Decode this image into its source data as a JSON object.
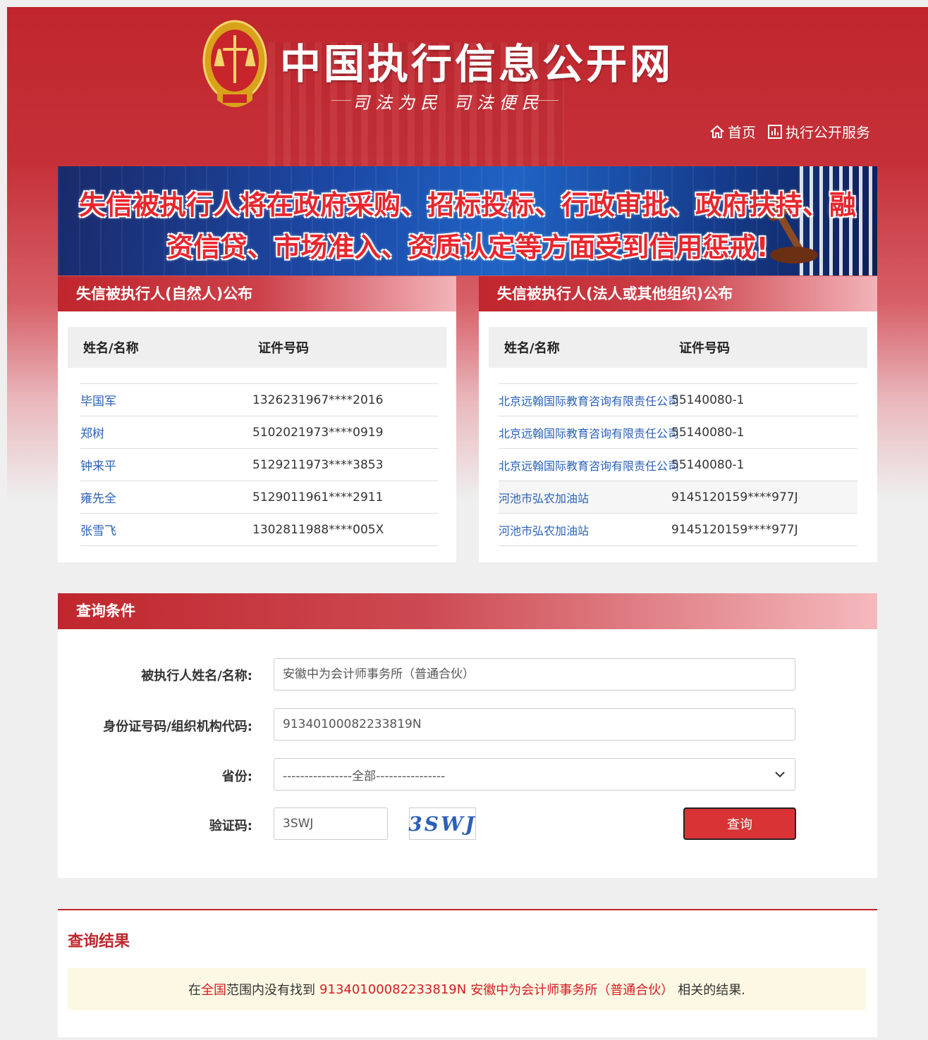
{
  "header": {
    "site_title": "中国执行信息公开网",
    "slogan": "司法为民  司法便民",
    "nav": [
      {
        "label": "首页",
        "icon": "home-icon"
      },
      {
        "label": "执行公开服务",
        "icon": "chart-icon"
      }
    ]
  },
  "banner": {
    "line1": "失信被执行人将在政府采购、招标投标、行政审批、政府扶持、融",
    "line2": "资信贷、市场准入、资质认定等方面受到信用惩戒!"
  },
  "natural_panel": {
    "title": "失信被执行人(自然人)公布",
    "col_name": "姓名/名称",
    "col_code": "证件号码",
    "rows": [
      {
        "name": "毕国军",
        "code": "1326231967****2016"
      },
      {
        "name": "郑树",
        "code": "5102021973****0919"
      },
      {
        "name": "钟来平",
        "code": "5129211973****3853"
      },
      {
        "name": "雍先全",
        "code": "5129011961****2911"
      },
      {
        "name": "张雪飞",
        "code": "1302811988****005X"
      }
    ]
  },
  "legal_panel": {
    "title": "失信被执行人(法人或其他组织)公布",
    "col_name": "姓名/名称",
    "col_code": "证件号码",
    "rows": [
      {
        "name": "北京远翰国际教育咨询有限责任公司",
        "code": "55140080-1"
      },
      {
        "name": "北京远翰国际教育咨询有限责任公司",
        "code": "55140080-1"
      },
      {
        "name": "北京远翰国际教育咨询有限责任公司",
        "code": "55140080-1"
      },
      {
        "name": "河池市弘农加油站",
        "code": "9145120159****977J"
      },
      {
        "name": "河池市弘农加油站",
        "code": "9145120159****977J"
      }
    ]
  },
  "query": {
    "title": "查询条件",
    "name_label": "被执行人姓名/名称:",
    "name_value": "安徽中为会计师事务所（普通合伙）",
    "id_label": "身份证号码/组织机构代码:",
    "id_value": "91340100082233819N",
    "province_label": "省份:",
    "province_value": "----------------全部----------------",
    "captcha_label": "验证码:",
    "captcha_value": "3SWJ",
    "captcha_image_text": "3SWJ",
    "submit_label": "查询"
  },
  "result": {
    "title": "查询结果",
    "prefix": "在",
    "scope": "全国",
    "mid": "范围内没有找到",
    "id": "91340100082233819N",
    "name": "安徽中为会计师事务所（普通合伙）",
    "suffix": "相关的结果."
  },
  "colors": {
    "brand_red": "#c0262d",
    "link_blue": "#2a61b8",
    "banner_blue": "#1f63c4"
  }
}
